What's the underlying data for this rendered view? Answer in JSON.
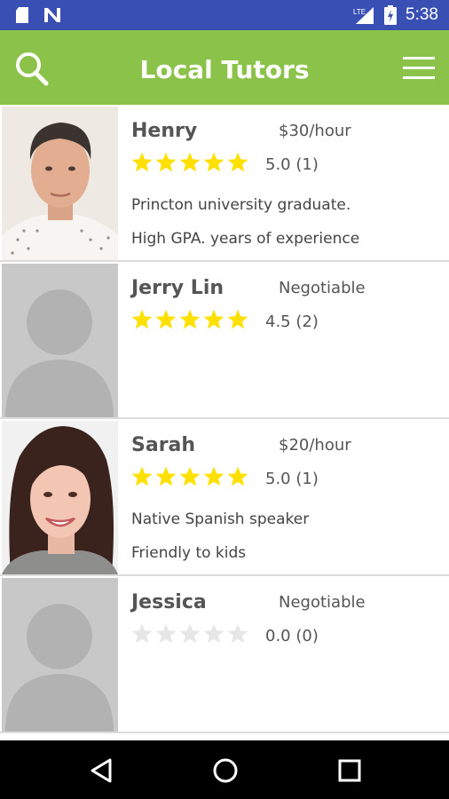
{
  "status_bar": {
    "time": "5:38",
    "network_label": "LTE",
    "icons": [
      "sd-card-icon",
      "notification-n-icon",
      "signal-icon",
      "battery-icon"
    ]
  },
  "app_bar": {
    "title": "Local Tutors",
    "search_icon": "search-icon",
    "menu_icon": "hamburger-menu-icon"
  },
  "colors": {
    "status_bar": "#3a4fb3",
    "app_bar": "#8bc34a",
    "star_filled": "#ffe000",
    "star_empty": "#e6e6e6"
  },
  "tutors": [
    {
      "name": "Henry",
      "price": "$30/hour",
      "stars": 5,
      "rating": "5.0 (1)",
      "line1": "Princton university graduate.",
      "line2": "High GPA. years of experience",
      "photo": "male-portrait"
    },
    {
      "name": "Jerry Lin",
      "price": "Negotiable",
      "stars": 5,
      "rating": "4.5 (2)",
      "line1": "",
      "line2": "",
      "photo": "placeholder-avatar"
    },
    {
      "name": "Sarah",
      "price": "$20/hour",
      "stars": 5,
      "rating": "5.0 (1)",
      "line1": "Native Spanish speaker",
      "line2": "Friendly to kids",
      "photo": "female-portrait"
    },
    {
      "name": "Jessica",
      "price": "Negotiable",
      "stars": 0,
      "rating": "0.0 (0)",
      "line1": "",
      "line2": "",
      "photo": "placeholder-avatar"
    }
  ],
  "nav_bar": {
    "icons": [
      "back-icon",
      "home-icon",
      "recents-icon"
    ]
  }
}
